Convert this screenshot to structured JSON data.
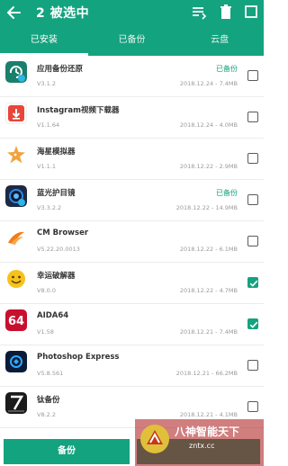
{
  "header": {
    "title": "2 被选中",
    "colors": {
      "primary": "#14a37f"
    },
    "icons": [
      "back-icon",
      "filter-list-icon",
      "delete-icon",
      "select-all-icon"
    ]
  },
  "tabs": [
    {
      "label": "已安装",
      "active": true
    },
    {
      "label": "已备份",
      "active": false
    },
    {
      "label": "云盘",
      "active": false
    }
  ],
  "apps": [
    {
      "name": "应用备份还原",
      "version": "V3.1.2",
      "meta": "2018.12.24 - 7.4MB",
      "status": "已备份",
      "checked": false,
      "icon": "backup-restore-icon"
    },
    {
      "name": "Instagram视频下载器",
      "version": "V1.1.64",
      "meta": "2018.12.24 - 4.0MB",
      "status": "",
      "checked": false,
      "icon": "instagram-downloader-icon"
    },
    {
      "name": "海星模拟器",
      "version": "V1.1.1",
      "meta": "2018.12.22 - 2.9MB",
      "status": "",
      "checked": false,
      "icon": "starfish-icon"
    },
    {
      "name": "蓝光护目镜",
      "version": "V3.3.2.2",
      "meta": "2018.12.22 - 14.9MB",
      "status": "已备份",
      "checked": false,
      "icon": "eye-filter-icon"
    },
    {
      "name": "CM Browser",
      "version": "V5.22.20.0013",
      "meta": "2018.12.22 - 6.1MB",
      "status": "",
      "checked": false,
      "icon": "cm-browser-icon"
    },
    {
      "name": "幸运破解器",
      "version": "V8.0.0",
      "meta": "2018.12.22 - 4.7MB",
      "status": "",
      "checked": true,
      "icon": "smiley-icon"
    },
    {
      "name": "AIDA64",
      "version": "V1.58",
      "meta": "2018.12.21 - 7.4MB",
      "status": "",
      "checked": true,
      "icon": "aida64-icon"
    },
    {
      "name": "Photoshop Express",
      "version": "V5.8.561",
      "meta": "2018.12.21 - 66.2MB",
      "status": "",
      "checked": false,
      "icon": "photoshop-express-icon"
    },
    {
      "name": "钛备份",
      "version": "V8.2.2",
      "meta": "2018.12.21 - 4.1MB",
      "status": "",
      "checked": false,
      "icon": "titanium-backup-icon"
    }
  ],
  "bottom": {
    "backup_label": "备份"
  },
  "watermark": {
    "title": "八神智能天下",
    "url": "zntx.cc"
  }
}
